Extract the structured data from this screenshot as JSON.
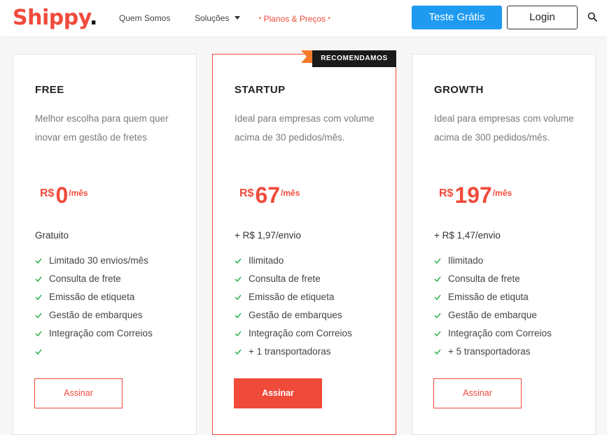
{
  "brand": {
    "logo_text": "Shippy",
    "logo_dot": ".",
    "accent": "#f04a3b",
    "blue": "#1e9bf0"
  },
  "nav": {
    "items": [
      "Quem Somos",
      "Soluções",
      "Planos & Preços"
    ],
    "planos_bullet": "•",
    "trial_button": "Teste Grátis",
    "login_button": "Login",
    "search_icon": "search-icon",
    "dropdown_icon": "caret-down-icon"
  },
  "plans": [
    {
      "name": "FREE",
      "description": "Melhor escolha para quem quer inovar em gestão de fretes",
      "currency": "R$",
      "price": "0",
      "period": "/mês",
      "per_send": "Gratuito",
      "features": [
        "Limitado 30 envios/mês",
        "Consulta de frete",
        "Emissão de etiqueta",
        "Gestão de embarques",
        "Integração com Correios",
        ""
      ],
      "button": "Assinar"
    },
    {
      "name": "STARTUP",
      "ribbon": "RECOMENDAMOS",
      "description": "Ideal para empresas com volume acima de 30 pedidos/mês.",
      "currency": "R$",
      "price": "67",
      "period": "/mês",
      "per_send": "+ R$ 1,97/envio",
      "features": [
        "Ilimitado",
        "Consulta de frete",
        "Emissão de etiqueta",
        "Gestão de embarques",
        "Integração com Correios",
        "+ 1 transportadoras"
      ],
      "button": "Assinar"
    },
    {
      "name": "GROWTH",
      "description": "Ideal para empresas com volume acima de 300 pedidos/mês.",
      "currency": "R$",
      "price": "197",
      "period": "/mês",
      "per_send": "+ R$ 1,47/envio",
      "features": [
        "Ilimitado",
        "Consulta de frete",
        "Emissão de etiquta",
        "Gestão de embarque",
        "Integração com Correios",
        "+ 5 transportadoras"
      ],
      "button": "Assinar"
    }
  ]
}
